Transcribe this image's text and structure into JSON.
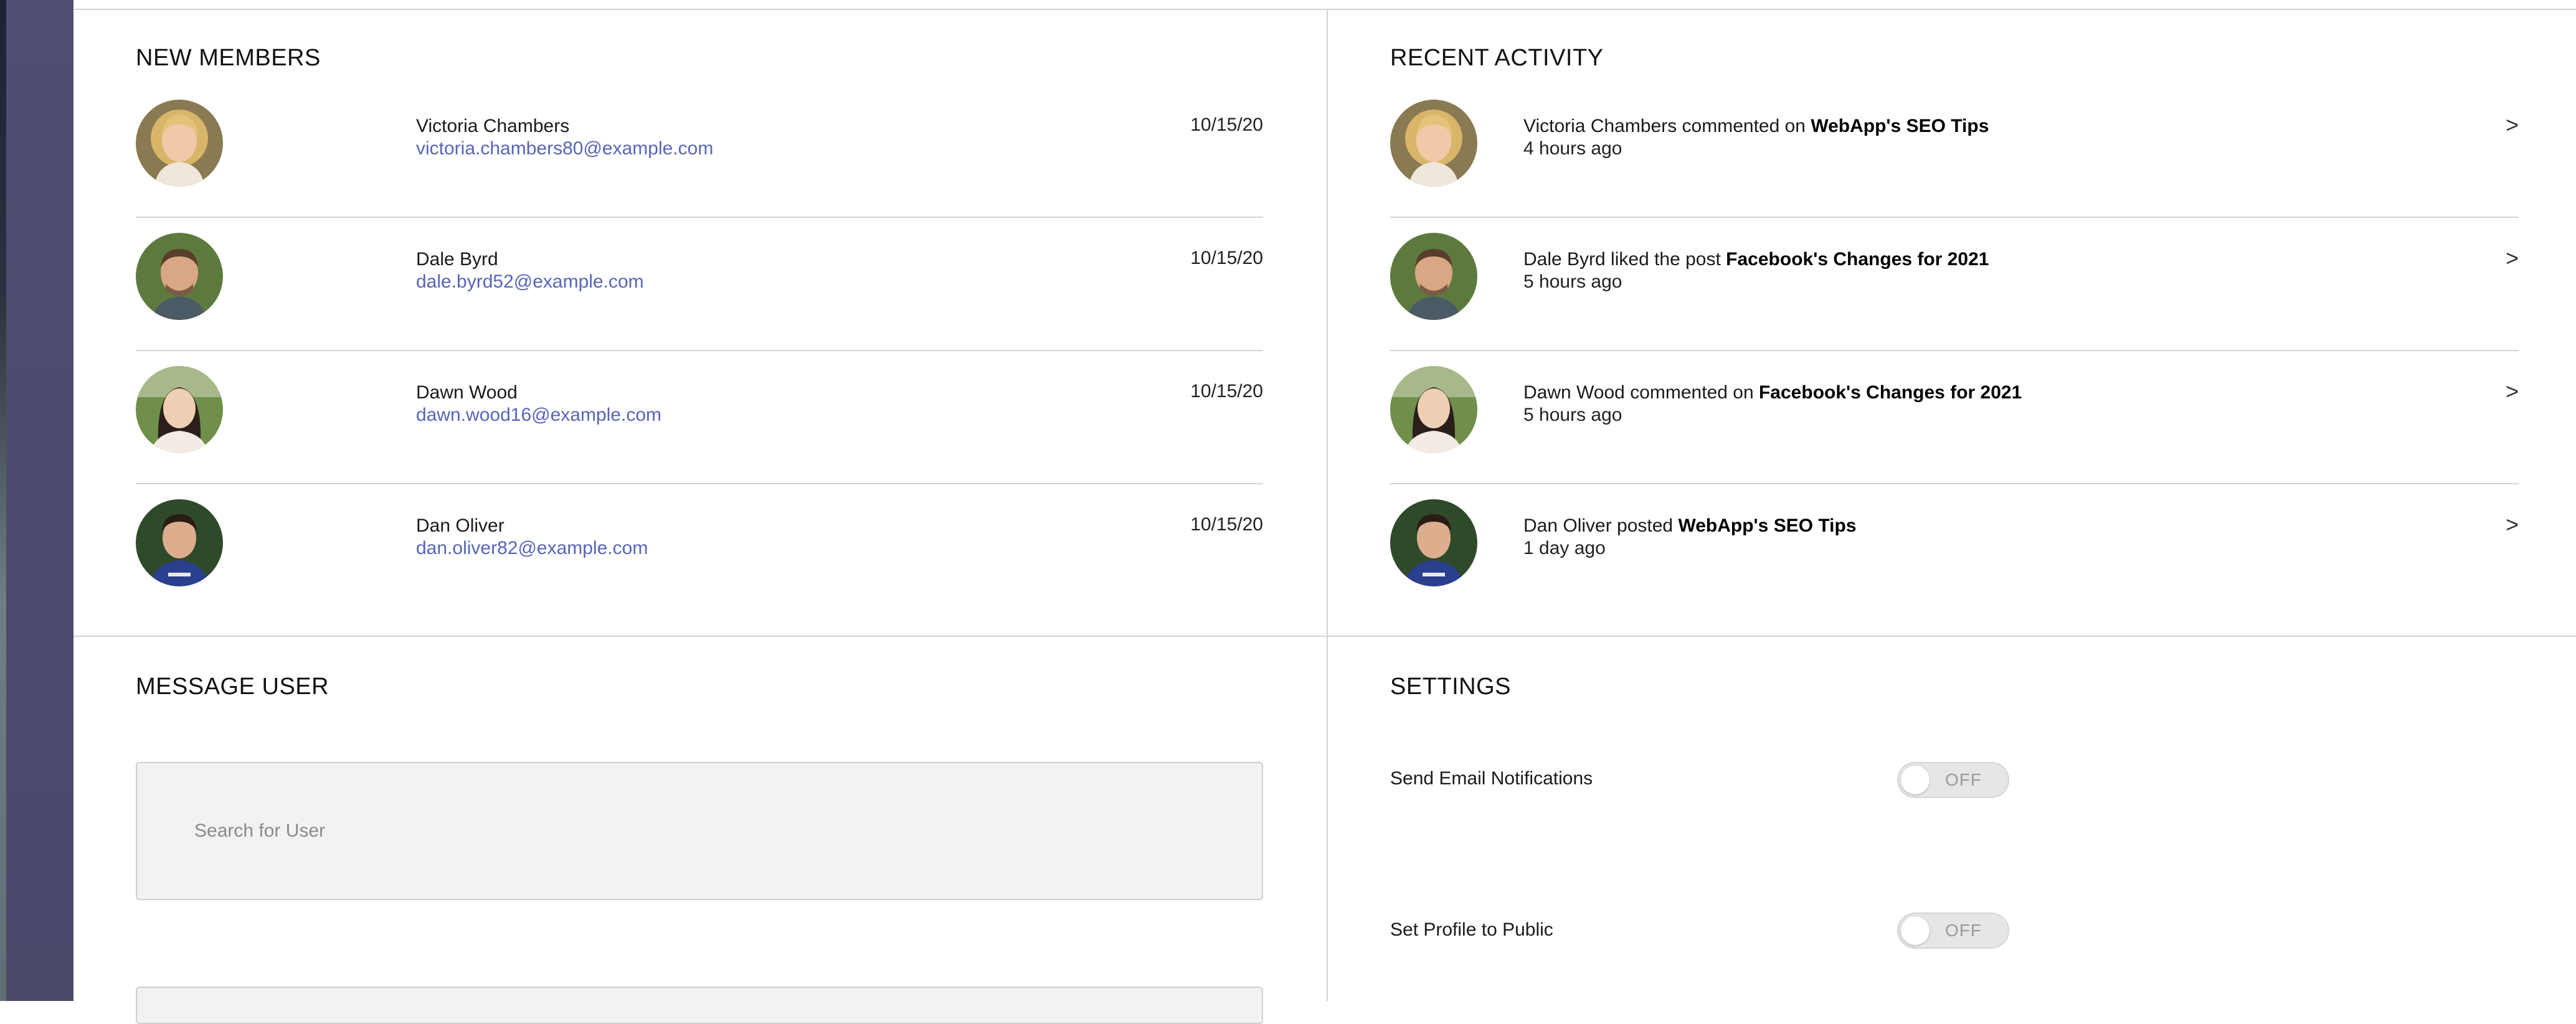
{
  "new_members": {
    "title": "NEW MEMBERS",
    "members": [
      {
        "name": "Victoria Chambers",
        "email": "victoria.chambers80@example.com",
        "date": "10/15/20"
      },
      {
        "name": "Dale Byrd",
        "email": "dale.byrd52@example.com",
        "date": "10/15/20"
      },
      {
        "name": "Dawn Wood",
        "email": "dawn.wood16@example.com",
        "date": "10/15/20"
      },
      {
        "name": "Dan Oliver",
        "email": "dan.oliver82@example.com",
        "date": "10/15/20"
      }
    ]
  },
  "recent_activity": {
    "title": "RECENT ACTIVITY",
    "items": [
      {
        "prefix": "Victoria Chambers commented on ",
        "target": "WebApp's SEO Tips",
        "time": "4 hours ago",
        "chevron": ">"
      },
      {
        "prefix": "Dale Byrd liked the post ",
        "target": "Facebook's Changes for 2021",
        "time": "5 hours ago",
        "chevron": ">"
      },
      {
        "prefix": "Dawn Wood commented on ",
        "target": "Facebook's Changes for 2021",
        "time": "5 hours ago",
        "chevron": ">"
      },
      {
        "prefix": "Dan Oliver posted ",
        "target": "WebApp's SEO Tips",
        "time": "1 day ago",
        "chevron": ">"
      }
    ]
  },
  "message_user": {
    "title": "MESSAGE USER",
    "search_placeholder": "Search for User"
  },
  "settings": {
    "title": "SETTINGS",
    "items": [
      {
        "label": "Send Email Notifications",
        "state": "OFF"
      },
      {
        "label": "Set Profile to Public",
        "state": "OFF"
      }
    ]
  },
  "colors": {
    "sidebar": "#4b4b6e",
    "email_link": "#5865b8",
    "divider": "#d4d4d4",
    "toggle_off": "#e6e6e6"
  }
}
